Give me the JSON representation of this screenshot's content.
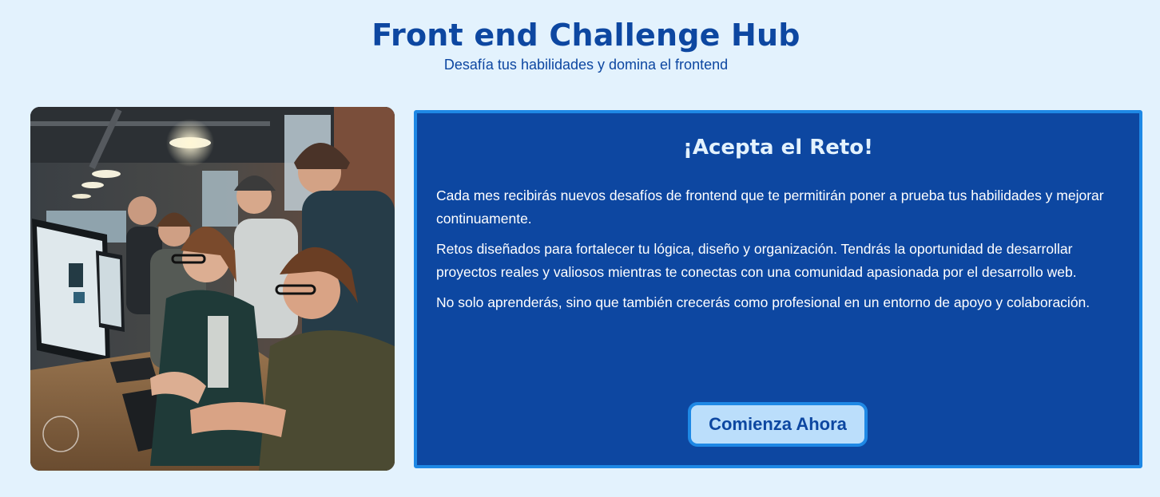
{
  "header": {
    "title": "Front end Challenge Hub",
    "subtitle": "Desafía tus habilidades y domina el frontend"
  },
  "hero_image": {
    "icon": "photo-developers-at-computers"
  },
  "card": {
    "title": "¡Acepta el Reto!",
    "paragraphs": [
      "Cada mes recibirás nuevos desafíos de frontend que te permitirán poner a prueba tus habilidades y mejorar continuamente.",
      "Retos diseñados para fortalecer tu lógica, diseño y organización. Tendrás la oportunidad de desarrollar proyectos reales y valiosos mientras te conectas con una comunidad apasionada por el desarrollo web.",
      "No solo aprenderás, sino que también crecerás como profesional en un entorno de apoyo y colaboración."
    ],
    "cta_label": "Comienza Ahora"
  },
  "colors": {
    "background": "#e3f2fd",
    "primary": "#0d47a1",
    "accent": "#1e88e5",
    "button_bg": "#bbdefb"
  }
}
